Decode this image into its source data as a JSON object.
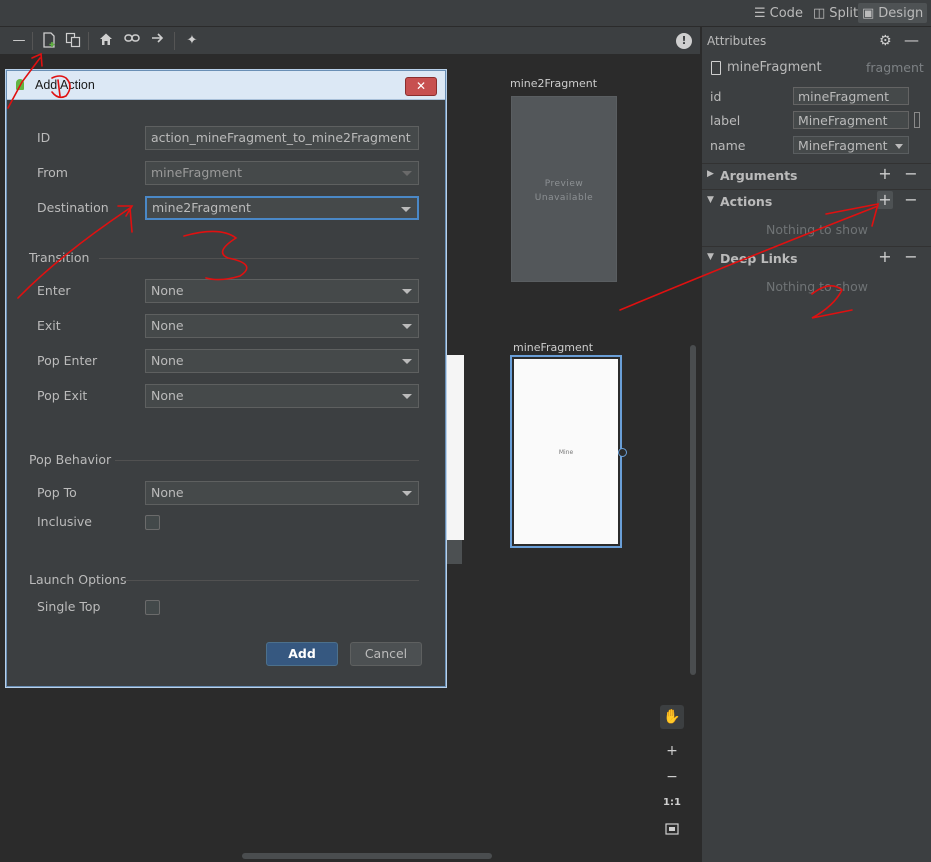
{
  "topbar": {
    "code_label": "Code",
    "split_label": "Split",
    "design_label": "Design"
  },
  "attributes": {
    "title": "Attributes",
    "component_name": "mineFragment",
    "component_type": "fragment",
    "fields": [
      {
        "label": "id",
        "value": "mineFragment"
      },
      {
        "label": "label",
        "value": "MineFragment"
      },
      {
        "label": "name",
        "value": "MineFragment"
      }
    ],
    "sections": {
      "arguments": "Arguments",
      "actions": "Actions",
      "actions_empty": "Nothing to show",
      "deep_links": "Deep Links",
      "deep_links_empty": "Nothing to show"
    }
  },
  "canvas": {
    "dest_fragment": {
      "name": "mine2Fragment",
      "preview_line1": "Preview",
      "preview_line2": "Unavailable"
    },
    "source_fragment": {
      "name": "mineFragment",
      "preview_text": "Mine"
    },
    "zoom": {
      "fit_label": "1:1"
    }
  },
  "dialog": {
    "title": "Add Action",
    "id_label": "ID",
    "id_value": "action_mineFragment_to_mine2Fragment",
    "from_label": "From",
    "from_value": "mineFragment",
    "destination_label": "Destination",
    "destination_value": "mine2Fragment",
    "transition_section": "Transition",
    "enter_label": "Enter",
    "enter_value": "None",
    "exit_label": "Exit",
    "exit_value": "None",
    "pop_enter_label": "Pop Enter",
    "pop_enter_value": "None",
    "pop_exit_label": "Pop Exit",
    "pop_exit_value": "None",
    "pop_behavior_section": "Pop Behavior",
    "pop_to_label": "Pop To",
    "pop_to_value": "None",
    "inclusive_label": "Inclusive",
    "launch_options_section": "Launch Options",
    "single_top_label": "Single Top",
    "add_button": "Add",
    "cancel_button": "Cancel"
  },
  "colors": {
    "accent": "#4a88c7",
    "annotation": "#e01010",
    "add_button": "#365880"
  }
}
